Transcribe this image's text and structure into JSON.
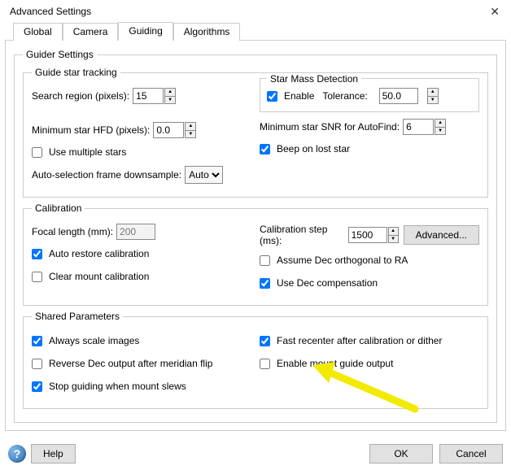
{
  "window": {
    "title": "Advanced Settings"
  },
  "tabs": {
    "global": "Global",
    "camera": "Camera",
    "guiding": "Guiding",
    "algorithms": "Algorithms"
  },
  "guiderSettings": {
    "legend": "Guider Settings",
    "guideStarTracking": {
      "legend": "Guide star tracking",
      "searchRegionLabel": "Search region (pixels):",
      "searchRegionValue": "15",
      "minHfdLabel": "Minimum star HFD (pixels):",
      "minHfdValue": "0.0",
      "useMultipleLabel": "Use multiple stars",
      "useMultipleChecked": false,
      "autoSelLabel": "Auto-selection frame downsample:",
      "autoSelValue": "Auto",
      "starMass": {
        "legend": "Star Mass Detection",
        "enableLabel": "Enable",
        "enableChecked": true,
        "toleranceLabel": "Tolerance:",
        "toleranceValue": "50.0"
      },
      "minSnrLabel": "Minimum star SNR for AutoFind:",
      "minSnrValue": "6",
      "beepLabel": "Beep on lost star",
      "beepChecked": true
    },
    "calibration": {
      "legend": "Calibration",
      "focalLabel": "Focal length (mm):",
      "focalValue": "200",
      "calStepLabel": "Calibration step (ms):",
      "calStepValue": "1500",
      "advancedBtn": "Advanced...",
      "autoRestoreLabel": "Auto restore calibration",
      "autoRestoreChecked": true,
      "assumeOrthLabel": "Assume Dec orthogonal to RA",
      "assumeOrthChecked": false,
      "clearMountLabel": "Clear mount calibration",
      "clearMountChecked": false,
      "useDecCompLabel": "Use Dec compensation",
      "useDecCompChecked": true
    },
    "shared": {
      "legend": "Shared Parameters",
      "alwaysScaleLabel": "Always scale images",
      "alwaysScaleChecked": true,
      "fastRecenterLabel": "Fast recenter after calibration or dither",
      "fastRecenterChecked": true,
      "reverseDecLabel": "Reverse Dec output after meridian flip",
      "reverseDecChecked": false,
      "enableMountLabel": "Enable mount guide output",
      "enableMountChecked": false,
      "stopGuidingLabel": "Stop guiding when mount slews",
      "stopGuidingChecked": true
    }
  },
  "buttons": {
    "help": "Help",
    "ok": "OK",
    "cancel": "Cancel"
  }
}
